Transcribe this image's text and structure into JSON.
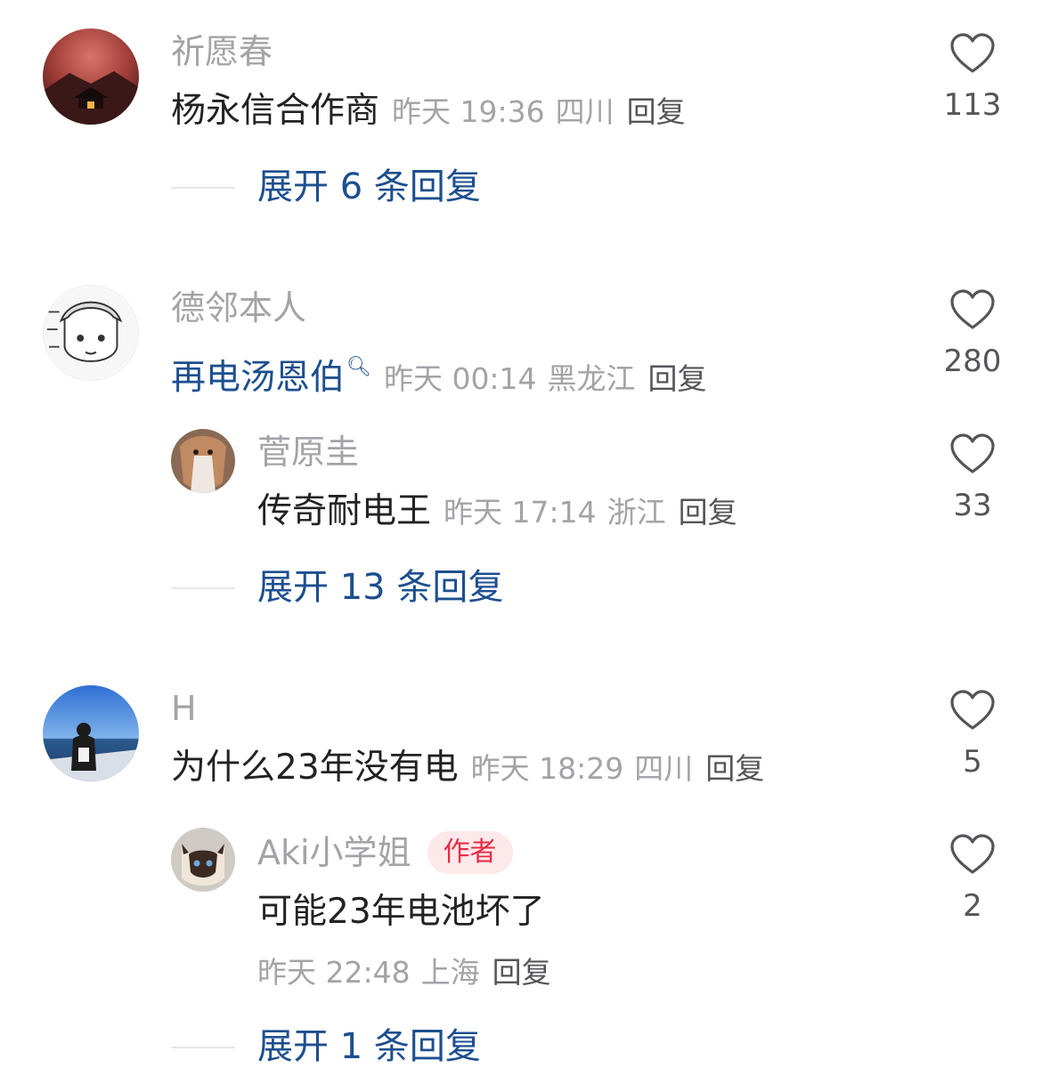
{
  "comments": [
    {
      "user": "祈愿春",
      "text": "杨永信合作商",
      "time": "昨天 19:36",
      "location": "四川",
      "reply": "回复",
      "likes": "113",
      "expand": "展开 6 条回复"
    },
    {
      "user": "德邻本人",
      "text": "再电汤恩伯",
      "mention_icon": "search-icon",
      "time": "昨天 00:14",
      "location": "黑龙江",
      "reply": "回复",
      "likes": "280",
      "replies": [
        {
          "user": "菅原圭",
          "text": "传奇耐电王",
          "time": "昨天 17:14",
          "location": "浙江",
          "reply": "回复",
          "likes": "33"
        }
      ],
      "expand": "展开 13 条回复"
    },
    {
      "user": "H",
      "text": "为什么23年没有电",
      "time": "昨天 18:29",
      "location": "四川",
      "reply": "回复",
      "likes": "5",
      "replies": [
        {
          "user": "Aki小学姐",
          "badge": "作者",
          "text": "可能23年电池坏了",
          "time": "昨天 22:48",
          "location": "上海",
          "reply": "回复",
          "likes": "2"
        }
      ],
      "expand": "展开 1 条回复"
    }
  ],
  "colors": {
    "username": "#a3a3a8",
    "meta": "#a3a3a8",
    "text": "#222222",
    "link": "#1d4f8f",
    "badge_bg": "#fde8ea",
    "badge_text": "#ea2b43"
  }
}
